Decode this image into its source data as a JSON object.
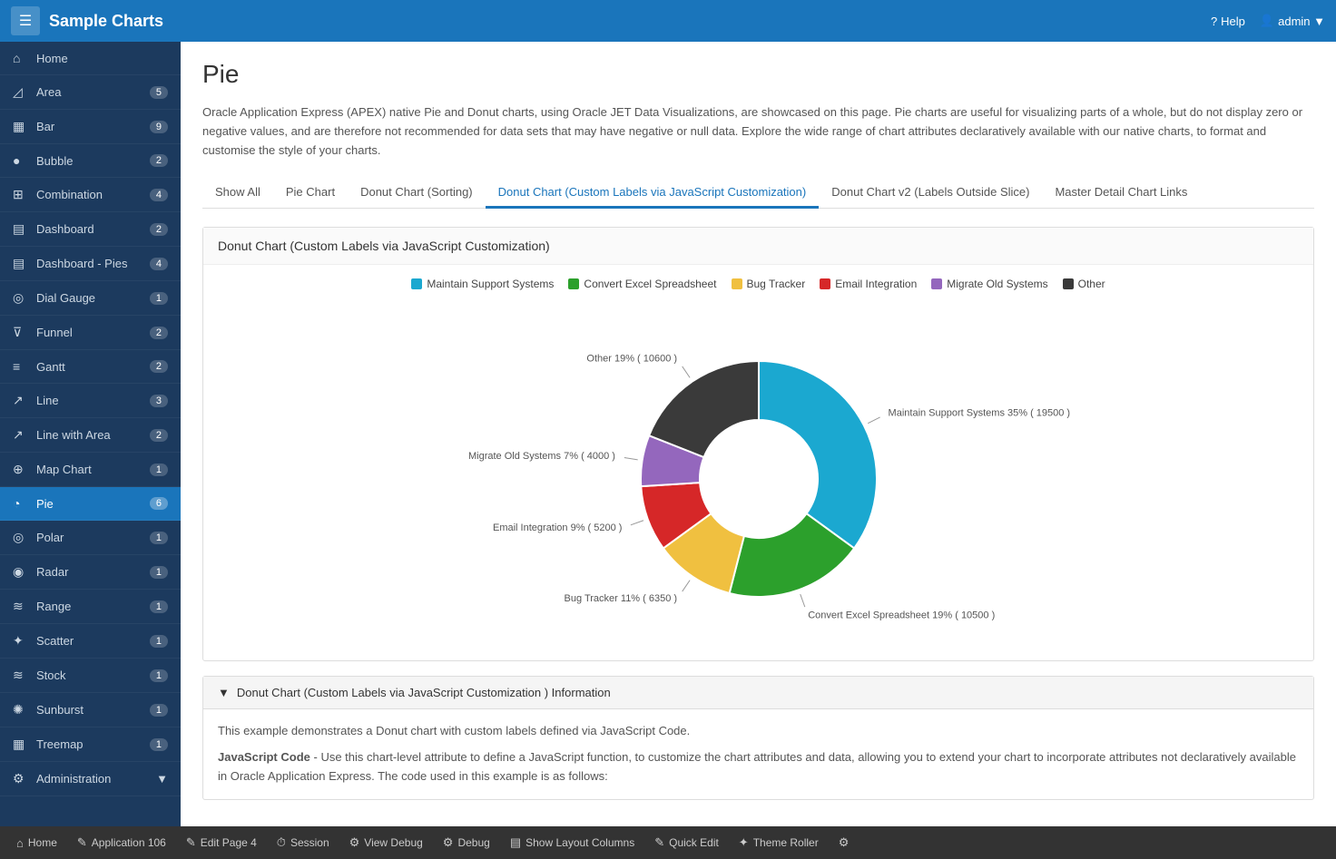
{
  "header": {
    "menu_icon": "☰",
    "title": "Sample Charts",
    "help_label": "Help",
    "admin_label": "admin ▼"
  },
  "sidebar": {
    "items": [
      {
        "id": "home",
        "label": "Home",
        "icon": "⌂",
        "badge": ""
      },
      {
        "id": "area",
        "label": "Area",
        "icon": "◿",
        "badge": "5"
      },
      {
        "id": "bar",
        "label": "Bar",
        "icon": "▦",
        "badge": "9"
      },
      {
        "id": "bubble",
        "label": "Bubble",
        "icon": "⬤",
        "badge": "2"
      },
      {
        "id": "combination",
        "label": "Combination",
        "icon": "⊞",
        "badge": "4"
      },
      {
        "id": "dashboard",
        "label": "Dashboard",
        "icon": "▤",
        "badge": "2"
      },
      {
        "id": "dashboard-pies",
        "label": "Dashboard - Pies",
        "icon": "▤",
        "badge": "4"
      },
      {
        "id": "dial-gauge",
        "label": "Dial Gauge",
        "icon": "◎",
        "badge": "1"
      },
      {
        "id": "funnel",
        "label": "Funnel",
        "icon": "⊽",
        "badge": "2"
      },
      {
        "id": "gantt",
        "label": "Gantt",
        "icon": "≡",
        "badge": "2"
      },
      {
        "id": "line",
        "label": "Line",
        "icon": "↗",
        "badge": "3"
      },
      {
        "id": "line-with-area",
        "label": "Line with Area",
        "icon": "↗",
        "badge": "2"
      },
      {
        "id": "map-chart",
        "label": "Map Chart",
        "icon": "⊕",
        "badge": "1"
      },
      {
        "id": "pie",
        "label": "Pie",
        "icon": "◔",
        "badge": "6",
        "active": true
      },
      {
        "id": "polar",
        "label": "Polar",
        "icon": "◎",
        "badge": "1"
      },
      {
        "id": "radar",
        "label": "Radar",
        "icon": "◎",
        "badge": "1"
      },
      {
        "id": "range",
        "label": "Range",
        "icon": "≋",
        "badge": "1"
      },
      {
        "id": "scatter",
        "label": "Scatter",
        "icon": "✦",
        "badge": "1"
      },
      {
        "id": "stock",
        "label": "Stock",
        "icon": "≋",
        "badge": "1"
      },
      {
        "id": "sunburst",
        "label": "Sunburst",
        "icon": "✺",
        "badge": "1"
      },
      {
        "id": "treemap",
        "label": "Treemap",
        "icon": "▦",
        "badge": "1"
      },
      {
        "id": "administration",
        "label": "Administration",
        "icon": "▾",
        "badge": "",
        "has_arrow": true
      }
    ]
  },
  "page": {
    "title": "Pie",
    "description": "Oracle Application Express (APEX) native Pie and Donut charts, using Oracle JET Data Visualizations, are showcased on this page. Pie charts are useful for visualizing parts of a whole, but do not display zero or negative values, and are therefore not recommended for data sets that may have negative or null data. Explore the wide range of chart attributes declaratively available with our native charts, to format and customise the style of your charts."
  },
  "tabs": [
    {
      "id": "show-all",
      "label": "Show All",
      "active": false
    },
    {
      "id": "pie-chart",
      "label": "Pie Chart",
      "active": false
    },
    {
      "id": "donut-sorting",
      "label": "Donut Chart (Sorting)",
      "active": false
    },
    {
      "id": "donut-custom",
      "label": "Donut Chart (Custom Labels via JavaScript Customization)",
      "active": true
    },
    {
      "id": "donut-v2",
      "label": "Donut Chart v2 (Labels Outside Slice)",
      "active": false
    },
    {
      "id": "master-detail",
      "label": "Master Detail Chart Links",
      "active": false
    }
  ],
  "chart": {
    "title": "Donut Chart (Custom Labels via JavaScript Customization)",
    "legend": [
      {
        "label": "Maintain Support Systems",
        "color": "#1ba8d0"
      },
      {
        "label": "Convert Excel Spreadsheet",
        "color": "#2ca02c"
      },
      {
        "label": "Bug Tracker",
        "color": "#f0c040"
      },
      {
        "label": "Email Integration",
        "color": "#d62728"
      },
      {
        "label": "Migrate Old Systems",
        "color": "#9467bd"
      },
      {
        "label": "Other",
        "color": "#3a3a3a"
      }
    ],
    "slices": [
      {
        "label": "Maintain Support Systems 35% ( 19500 )",
        "value": 19500,
        "pct": 35,
        "color": "#1ba8d0",
        "startAngle": -90,
        "endAngle": 36
      },
      {
        "label": "Convert Excel Spreadsheet 19% ( 10500 )",
        "value": 10500,
        "pct": 19,
        "color": "#2ca02c",
        "startAngle": 36,
        "endAngle": 104.4
      },
      {
        "label": "Bug Tracker 11% ( 6350 )",
        "value": 6350,
        "pct": 11,
        "color": "#f0c040",
        "startAngle": 104.4,
        "endAngle": 144
      },
      {
        "label": "Email Integration 9% ( 5200 )",
        "value": 5200,
        "pct": 9,
        "color": "#d62728",
        "startAngle": 144,
        "endAngle": 176.4
      },
      {
        "label": "Migrate Old Systems 7% ( 4000 )",
        "value": 4000,
        "pct": 7,
        "color": "#9467bd",
        "startAngle": 176.4,
        "endAngle": 201.6
      },
      {
        "label": "Other 19% ( 10600 )",
        "value": 10600,
        "pct": 19,
        "color": "#3a3a3a",
        "startAngle": 201.6,
        "endAngle": 270
      }
    ]
  },
  "info": {
    "header": "Donut Chart (Custom Labels via JavaScript Customization ) Information",
    "body_line1": "This example demonstrates a Donut chart with custom labels defined via JavaScript Code.",
    "body_line2": "JavaScript Code - Use this chart-level attribute to define a JavaScript function, to customize the chart attributes and data, allowing you to extend your chart to incorporate attributes not declaratively available in Oracle Application Express. The code used in this example is as follows:"
  },
  "bottom_bar": {
    "buttons": [
      {
        "id": "home",
        "icon": "⌂",
        "label": "Home"
      },
      {
        "id": "application",
        "icon": "✎",
        "label": "Application 106"
      },
      {
        "id": "edit-page",
        "icon": "✎",
        "label": "Edit Page 4"
      },
      {
        "id": "session",
        "icon": "⏱",
        "label": "Session"
      },
      {
        "id": "view-debug",
        "icon": "⚙",
        "label": "View Debug"
      },
      {
        "id": "debug",
        "icon": "⚙",
        "label": "Debug"
      },
      {
        "id": "show-layout",
        "icon": "▤",
        "label": "Show Layout Columns"
      },
      {
        "id": "quick-edit",
        "icon": "✎",
        "label": "Quick Edit"
      },
      {
        "id": "theme-roller",
        "icon": "✦",
        "label": "Theme Roller"
      },
      {
        "id": "settings",
        "icon": "⚙",
        "label": ""
      }
    ]
  }
}
